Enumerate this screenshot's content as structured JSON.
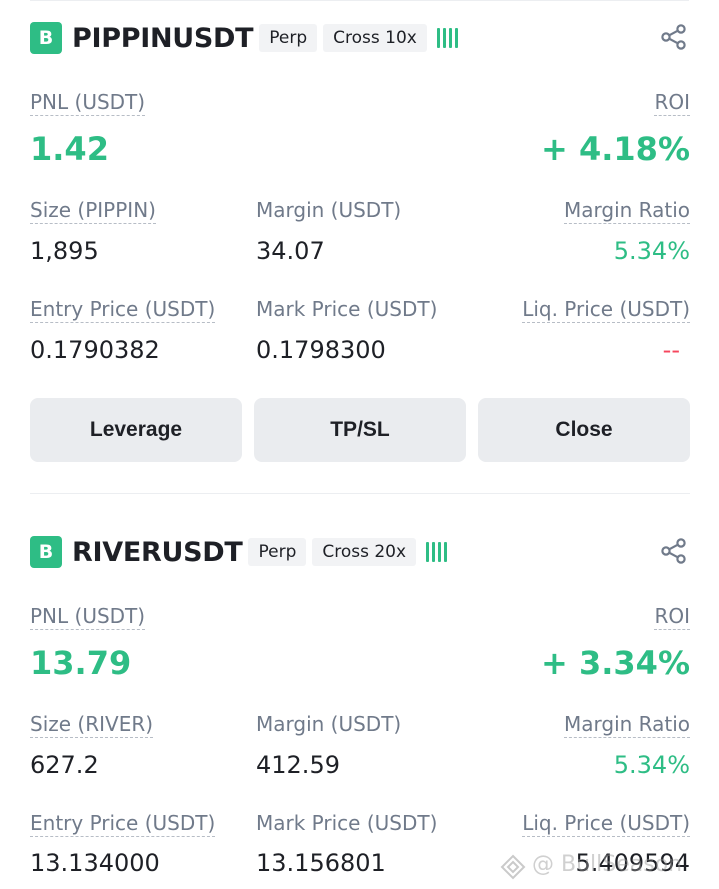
{
  "colors": {
    "accent_green": "#2ebd85",
    "negative_red": "#f6465d",
    "label_gray": "#707a8a",
    "button_bg": "#eaecef"
  },
  "positions": [
    {
      "side_badge": "B",
      "symbol": "PIPPINUSDT",
      "type_tag": "Perp",
      "margin_tag": "Cross 10x",
      "pnl_label": "PNL (USDT)",
      "pnl_value": "1.42",
      "roi_label": "ROI",
      "roi_value": "+ 4.18%",
      "size_label": "Size (PIPPIN)",
      "size_value": "1,895",
      "margin_label": "Margin (USDT)",
      "margin_value": "34.07",
      "margin_ratio_label": "Margin Ratio",
      "margin_ratio_value": "5.34%",
      "entry_label": "Entry Price (USDT)",
      "entry_value": "0.1790382",
      "mark_label": "Mark Price (USDT)",
      "mark_value": "0.1798300",
      "liq_label": "Liq. Price (USDT)",
      "liq_value": "--",
      "buttons": {
        "leverage": "Leverage",
        "tpsl": "TP/SL",
        "close": "Close"
      },
      "icons": {
        "share": "share-icon"
      }
    },
    {
      "side_badge": "B",
      "symbol": "RIVERUSDT",
      "type_tag": "Perp",
      "margin_tag": "Cross 20x",
      "pnl_label": "PNL (USDT)",
      "pnl_value": "13.79",
      "roi_label": "ROI",
      "roi_value": "+ 3.34%",
      "size_label": "Size (RIVER)",
      "size_value": "627.2",
      "margin_label": "Margin (USDT)",
      "margin_value": "412.59",
      "margin_ratio_label": "Margin Ratio",
      "margin_ratio_value": "5.34%",
      "entry_label": "Entry Price (USDT)",
      "entry_value": "13.134000",
      "mark_label": "Mark Price (USDT)",
      "mark_value": "13.156801",
      "liq_label": "Liq. Price (USDT)",
      "liq_value": "5.409594",
      "icons": {
        "share": "share-icon"
      }
    }
  ],
  "watermark": {
    "text": "@ BullSeason"
  }
}
